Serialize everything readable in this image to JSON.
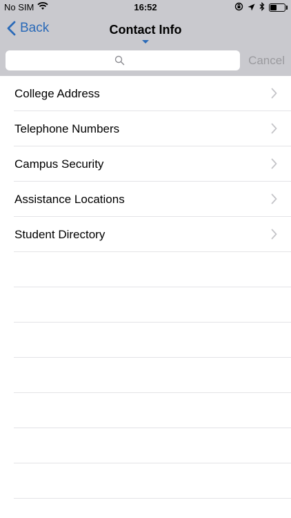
{
  "status_bar": {
    "carrier": "No SIM",
    "time": "16:52",
    "battery_level": 0.4
  },
  "nav": {
    "back_label": "Back",
    "title": "Contact Info",
    "accent_color": "#2a6ab8"
  },
  "search": {
    "value": "",
    "placeholder": "",
    "cancel_label": "Cancel"
  },
  "list": {
    "items": [
      {
        "label": "College Address"
      },
      {
        "label": "Telephone Numbers"
      },
      {
        "label": "Campus Security"
      },
      {
        "label": "Assistance Locations"
      },
      {
        "label": "Student Directory"
      }
    ]
  }
}
